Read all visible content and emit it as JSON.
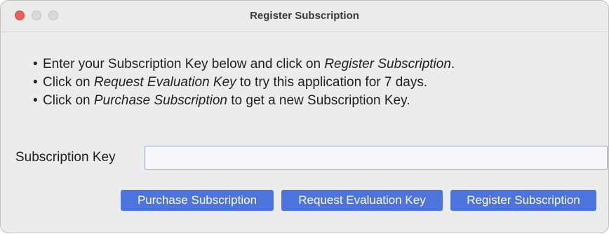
{
  "window": {
    "title": "Register Subscription"
  },
  "instructions": {
    "bullet": "•",
    "line1": {
      "prefix": "Enter your Subscription Key below and click on ",
      "emph": "Register Subscription",
      "suffix": "."
    },
    "line2": {
      "prefix": "Click on ",
      "emph": "Request Evaluation Key",
      "suffix": " to try this application for 7 days."
    },
    "line3": {
      "prefix": "Click on ",
      "emph": "Purchase Subscription",
      "suffix": " to get a new Subscription Key."
    }
  },
  "form": {
    "key_label": "Subscription Key",
    "key_value": "",
    "key_placeholder": ""
  },
  "buttons": {
    "purchase": "Purchase Subscription",
    "request": "Request Evaluation Key",
    "register": "Register Subscription"
  },
  "colors": {
    "accent": "#4d73dc",
    "close": "#ec5f58"
  }
}
